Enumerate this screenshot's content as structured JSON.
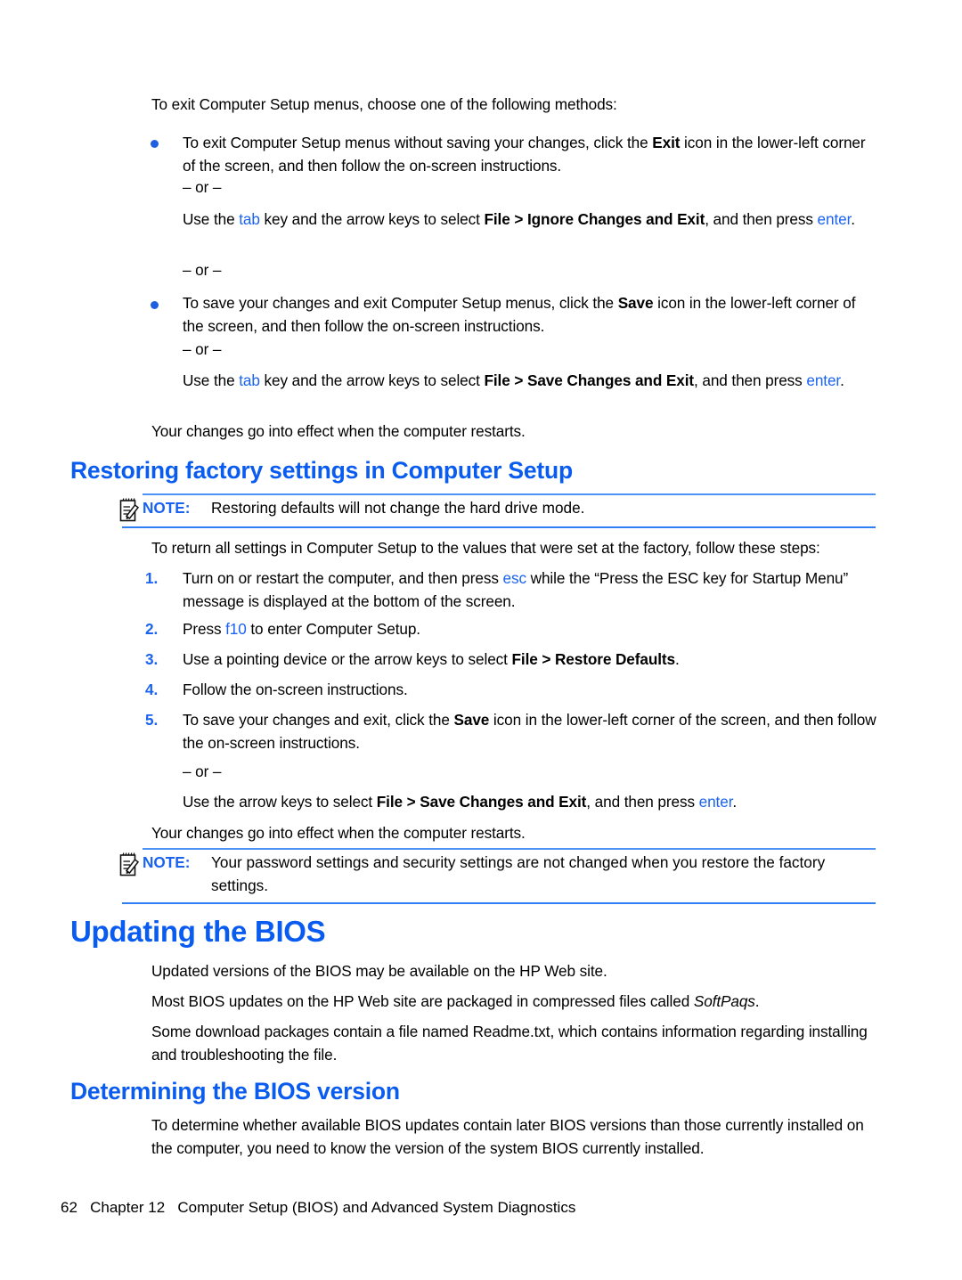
{
  "document": {
    "type": "user-guide-page",
    "accent_color": "#0a5cf0",
    "key_color": "#1a63f0",
    "note_rule_color": "#4d93f7",
    "text_color": "#000000",
    "background": "#ffffff"
  },
  "intro": {
    "lead": "To exit Computer Setup menus, choose one of the following methods:"
  },
  "or_label": "– or –",
  "exit_bullets": [
    {
      "text_before": "To exit Computer Setup menus without saving your changes, click the ",
      "bold": "Exit",
      "text_after": " icon in the lower-left corner of the screen, and then follow the on-screen instructions."
    },
    {
      "text_before": "To save your changes and exit Computer Setup menus, click the ",
      "bold": "Save",
      "text_after": " icon in the lower-left corner of the screen, and then follow the on-screen instructions."
    }
  ],
  "alt_ignore": {
    "p1": "Use the ",
    "key1": "tab",
    "p2": " key and the arrow keys to select ",
    "bold": "File > Ignore Changes and Exit",
    "p3": ", and then press ",
    "key2": "enter",
    "p4": "."
  },
  "alt_save": {
    "p1": "Use the ",
    "key1": "tab",
    "p2": " key and the arrow keys to select ",
    "bold": "File > Save Changes and Exit",
    "p3": ", and then press ",
    "key2": "enter",
    "p4": "."
  },
  "restart_note": "Your changes go into effect when the computer restarts.",
  "heading_restoring": "Restoring factory settings in Computer Setup",
  "note_1": {
    "label": "NOTE:",
    "text": "Restoring defaults will not change the hard drive mode.",
    "icon": "note-pad-pencil-icon"
  },
  "restore_intro": "To return all settings in Computer Setup to the values that were set at the factory, follow these steps:",
  "steps": [
    {
      "number": "1.",
      "p1": "Turn on or restart the computer, and then press ",
      "key": "esc",
      "p2": " while the “Press the ESC key for Startup Menu” message is displayed at the bottom of the screen."
    },
    {
      "number": "2.",
      "p1": "Press ",
      "key": "f10",
      "p2": " to enter Computer Setup."
    },
    {
      "number": "3.",
      "p1": "Use a pointing device or the arrow keys to select ",
      "bold": "File > Restore Defaults",
      "p2": "."
    },
    {
      "number": "4.",
      "p1": "Follow the on-screen instructions."
    },
    {
      "number": "5.",
      "p1": "To save your changes and exit, click the ",
      "bold": "Save",
      "p2": " icon in the lower-left corner of the screen, and then follow the on-screen instructions."
    }
  ],
  "step5_alt": {
    "p1": "Use the arrow keys to select ",
    "bold": "File > Save Changes and Exit",
    "p2": ", and then press ",
    "key": "enter",
    "p3": "."
  },
  "restart_note_2": "Your changes go into effect when the computer restarts.",
  "note_2": {
    "label": "NOTE:",
    "text": "Your password settings and security settings are not changed when you restore the factory settings.",
    "icon": "note-pad-pencil-icon"
  },
  "heading_updating": "Updating the BIOS",
  "updating_paras": [
    {
      "text": "Updated versions of the BIOS may be available on the HP Web site."
    }
  ],
  "softpaq_para": {
    "p1": "Most BIOS updates on the HP Web site are packaged in compressed files called ",
    "italic": "SoftPaqs",
    "p2": "."
  },
  "readme_para": "Some download packages contain a file named Readme.txt, which contains information regarding installing and troubleshooting the file.",
  "heading_determining": "Determining the BIOS version",
  "determining_para": "To determine whether available BIOS updates contain later BIOS versions than those currently installed on the computer, you need to know the version of the system BIOS currently installed.",
  "footer": {
    "page_number": "62",
    "chapter": "Chapter 12",
    "title": "Computer Setup (BIOS) and Advanced System Diagnostics"
  }
}
